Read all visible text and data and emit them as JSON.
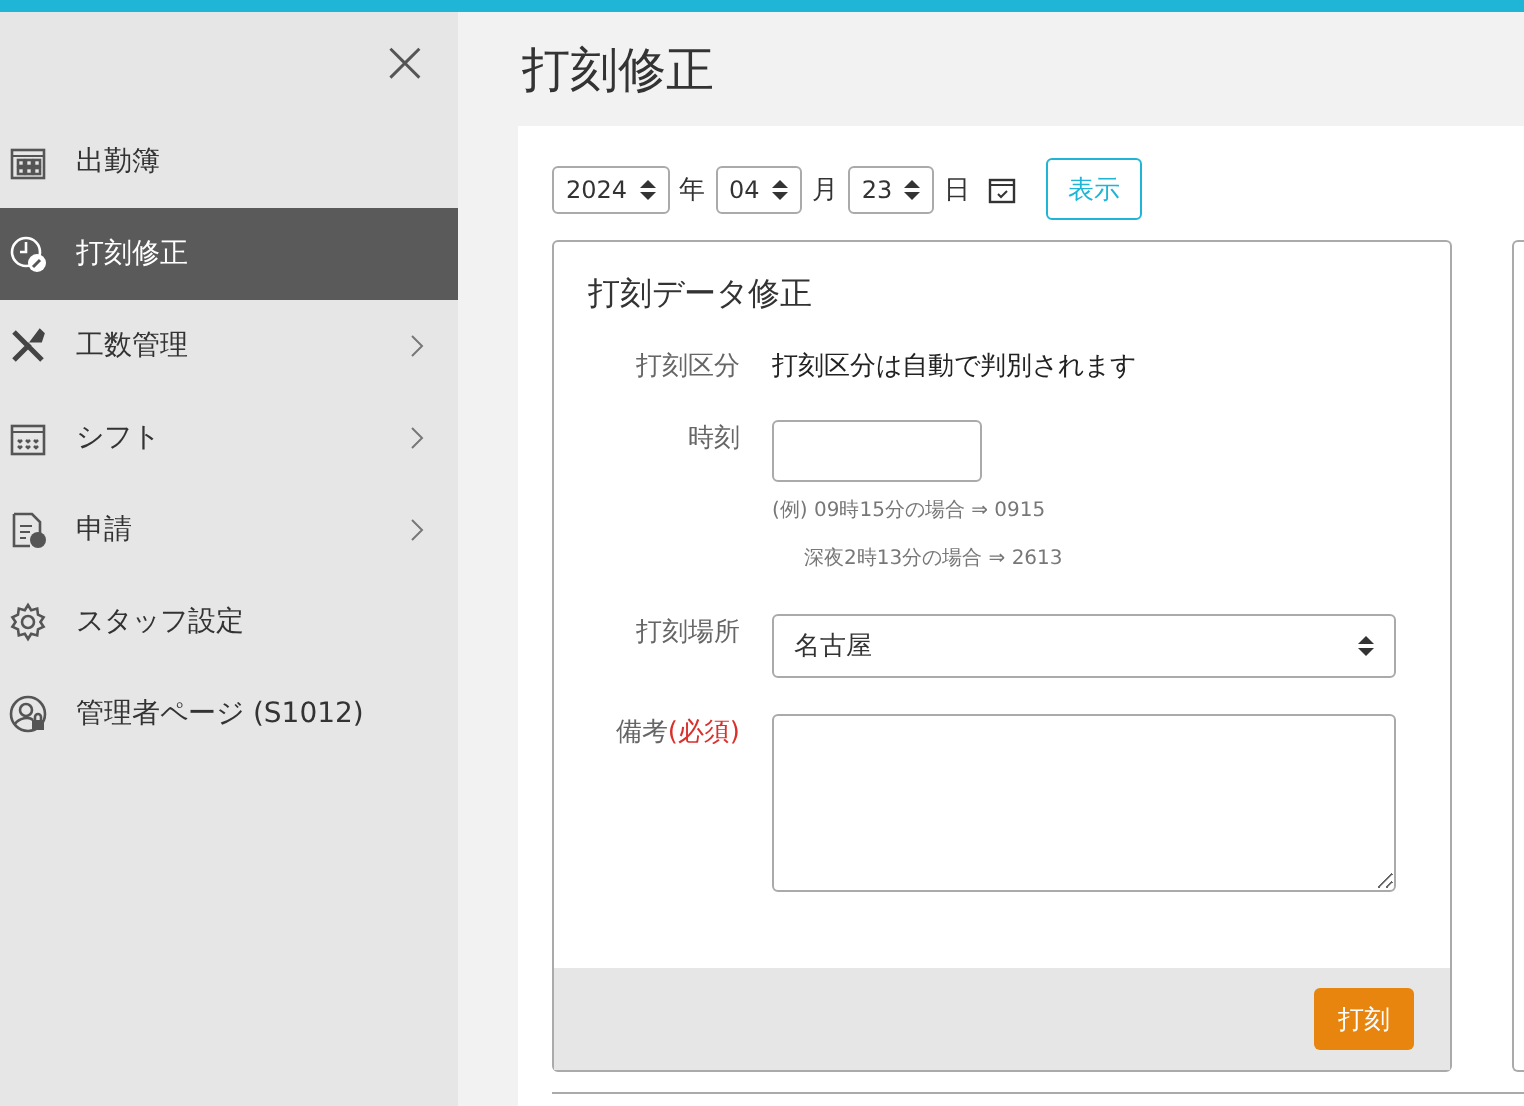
{
  "sidebar": {
    "close": "×",
    "items": [
      {
        "label": "出勤簿",
        "selected": false,
        "expandable": false
      },
      {
        "label": "打刻修正",
        "selected": true,
        "expandable": false
      },
      {
        "label": "工数管理",
        "selected": false,
        "expandable": true
      },
      {
        "label": "シフト",
        "selected": false,
        "expandable": true
      },
      {
        "label": "申請",
        "selected": false,
        "expandable": true
      },
      {
        "label": "スタッフ設定",
        "selected": false,
        "expandable": false
      },
      {
        "label": "管理者ページ (S1012)",
        "selected": false,
        "expandable": false
      }
    ]
  },
  "page_title": "打刻修正",
  "date_picker": {
    "year": "2024",
    "year_unit": "年",
    "month": "04",
    "month_unit": "月",
    "day": "23",
    "day_unit": "日",
    "show_button": "表示"
  },
  "form": {
    "title": "打刻データ修正",
    "type_label": "打刻区分",
    "type_value": "打刻区分は自動で判別されます",
    "time_label": "時刻",
    "time_hints": [
      "(例) 09時15分の場合 ⇒ 0915",
      "深夜2時13分の場合 ⇒ 2613"
    ],
    "place_label": "打刻場所",
    "place_value": "名古屋",
    "note_label": "備考",
    "note_required": "(必須)",
    "submit": "打刻"
  }
}
